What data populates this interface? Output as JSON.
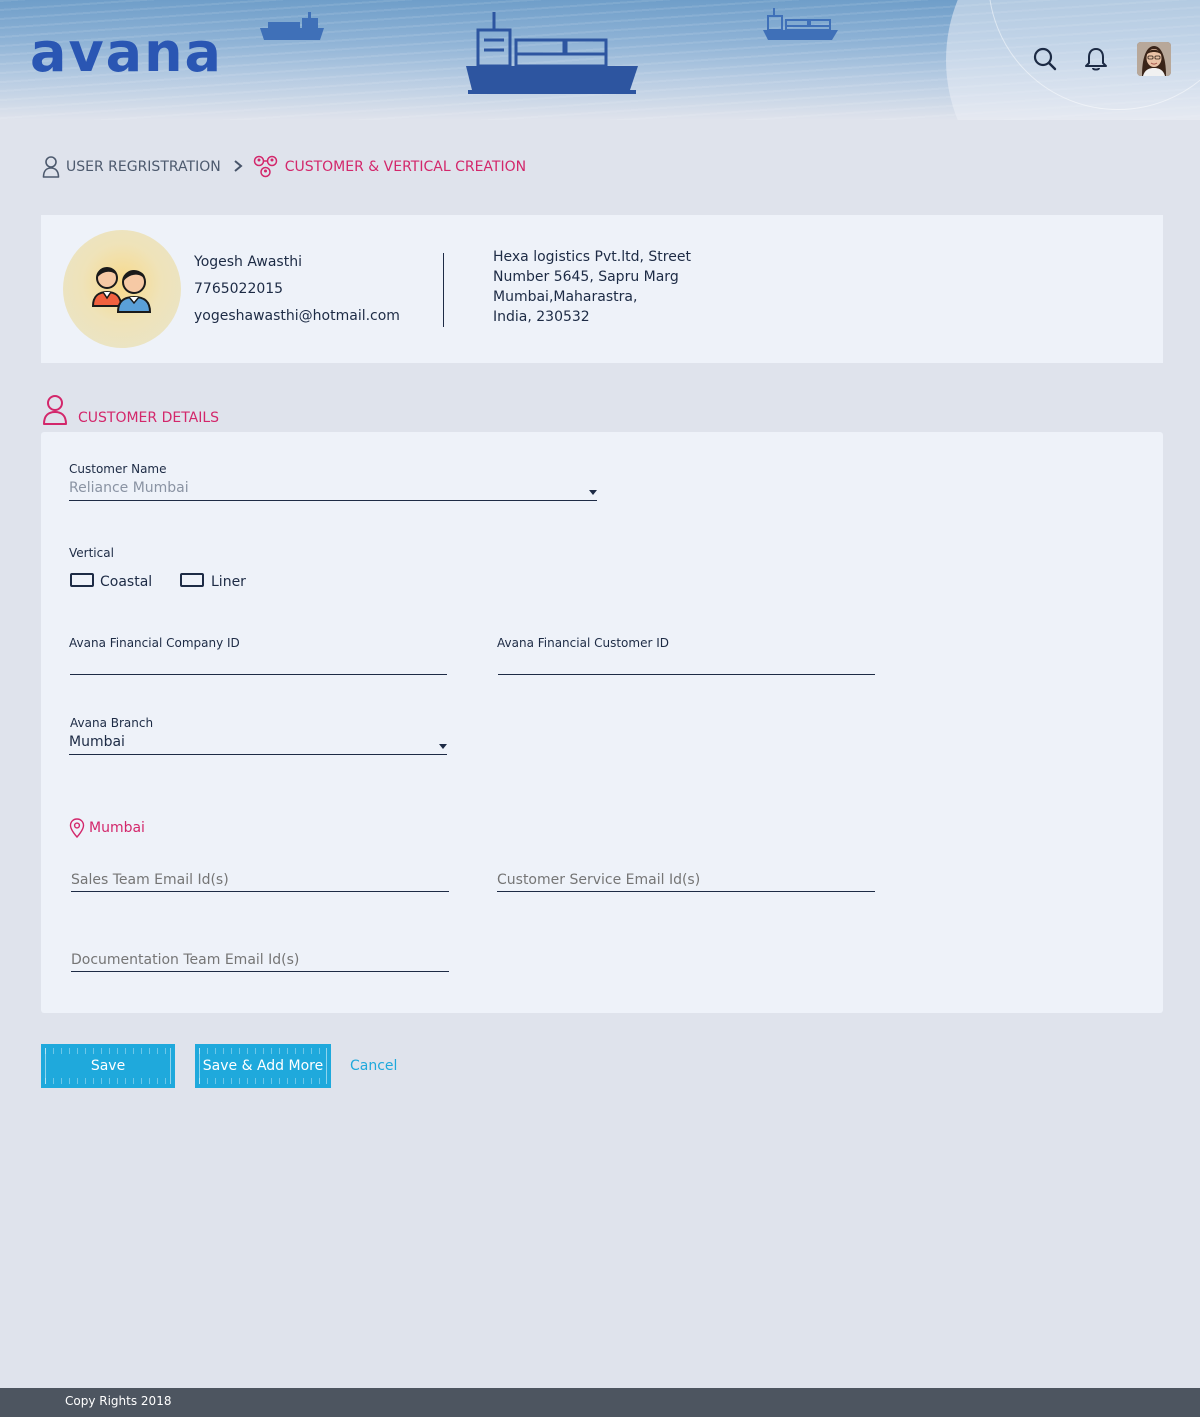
{
  "header": {
    "logo": "avana",
    "icons": [
      "search-icon",
      "bell-icon"
    ],
    "avatar": "user-avatar"
  },
  "breadcrumb": {
    "step1": "USER REGRISTRATION",
    "step2": "CUSTOMER & VERTICAL CREATION"
  },
  "profile": {
    "name": "Yogesh Awasthi",
    "phone": "7765022015",
    "email": "yogeshawasthi@hotmail.com",
    "address": [
      "Hexa logistics Pvt.ltd, Street",
      "Number 5645, Sapru Marg",
      "Mumbai,Maharastra,",
      "India, 230532"
    ]
  },
  "section": {
    "title": "CUSTOMER DETAILS"
  },
  "form": {
    "customer_name": {
      "label": "Customer Name",
      "value": "Reliance Mumbai"
    },
    "vertical": {
      "label": "Vertical",
      "options": [
        "Coastal",
        "Liner"
      ]
    },
    "company_id": {
      "label": "Avana Financial Company ID",
      "value": ""
    },
    "customer_id": {
      "label": "Avana Financial Customer ID",
      "value": ""
    },
    "branch": {
      "label": "Avana Branch",
      "value": "Mumbai"
    },
    "location": "Mumbai",
    "sales_email": {
      "placeholder": "Sales Team Email Id(s)"
    },
    "cs_email": {
      "placeholder": "Customer Service Email Id(s)"
    },
    "doc_email": {
      "placeholder": "Documentation Team Email Id(s)"
    }
  },
  "actions": {
    "save": "Save",
    "save_add": "Save & Add More",
    "cancel": "Cancel"
  },
  "footer": {
    "copyright": "Copy Rights 2018"
  },
  "colors": {
    "accent_pink": "#d3276b",
    "button_blue": "#1fa9dc",
    "logo_blue": "#2a56b3",
    "text_navy": "#1d2b45"
  }
}
